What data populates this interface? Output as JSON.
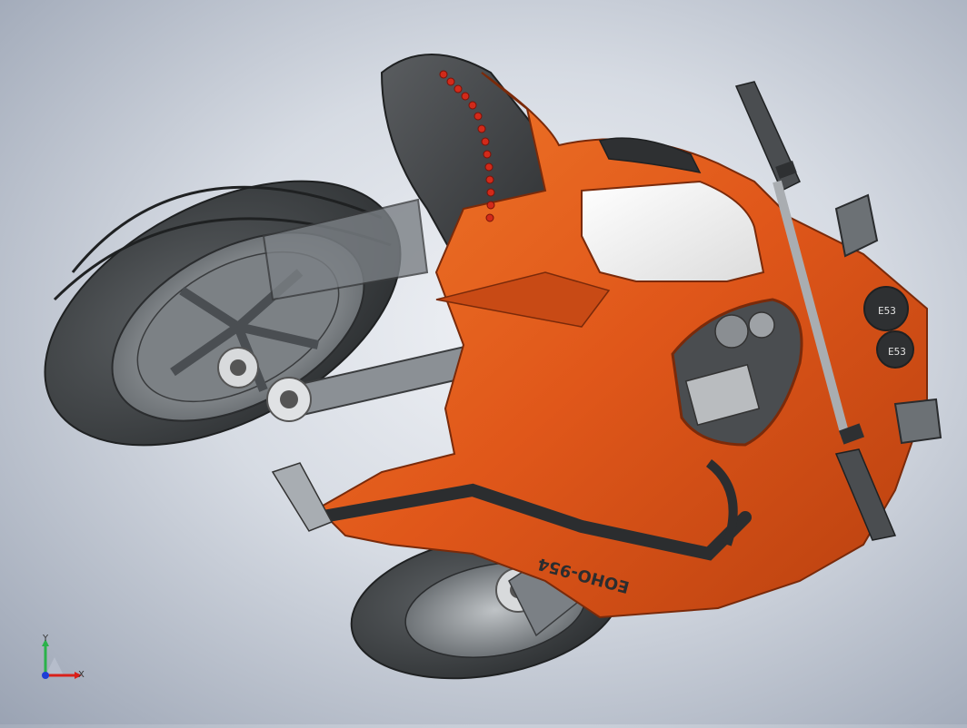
{
  "viewport": {
    "background_top": "#f0f2f6",
    "background_bottom": "#9aa3b3"
  },
  "model": {
    "body_color": "#e0571a",
    "body_shadow": "#8f2c0a",
    "seat_color": "#3a3c3e",
    "tire_color": "#3b3e40",
    "rim_color": "#6f757a",
    "panel_color": "#f2f2f2",
    "led_color": "#d22a1a",
    "decal_text": "EOHO-954",
    "gauge_left_text": "E53",
    "gauge_right_text": "E53"
  },
  "triad": {
    "x_label": "X",
    "y_label": "Y",
    "x_color": "#d9201a",
    "y_color": "#2ab24a",
    "z_color": "#1f3fd6"
  }
}
